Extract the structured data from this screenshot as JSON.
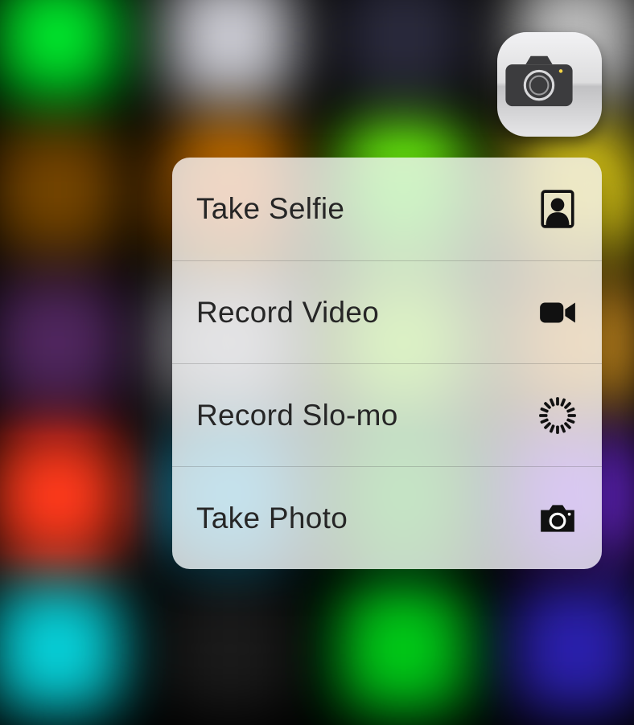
{
  "app": {
    "name": "Camera",
    "icon": "camera-icon"
  },
  "menu": {
    "items": [
      {
        "label": "Take Selfie",
        "icon": "selfie-icon"
      },
      {
        "label": "Record Video",
        "icon": "video-icon"
      },
      {
        "label": "Record Slo-mo",
        "icon": "slomo-icon"
      },
      {
        "label": "Take Photo",
        "icon": "photo-icon"
      }
    ]
  }
}
